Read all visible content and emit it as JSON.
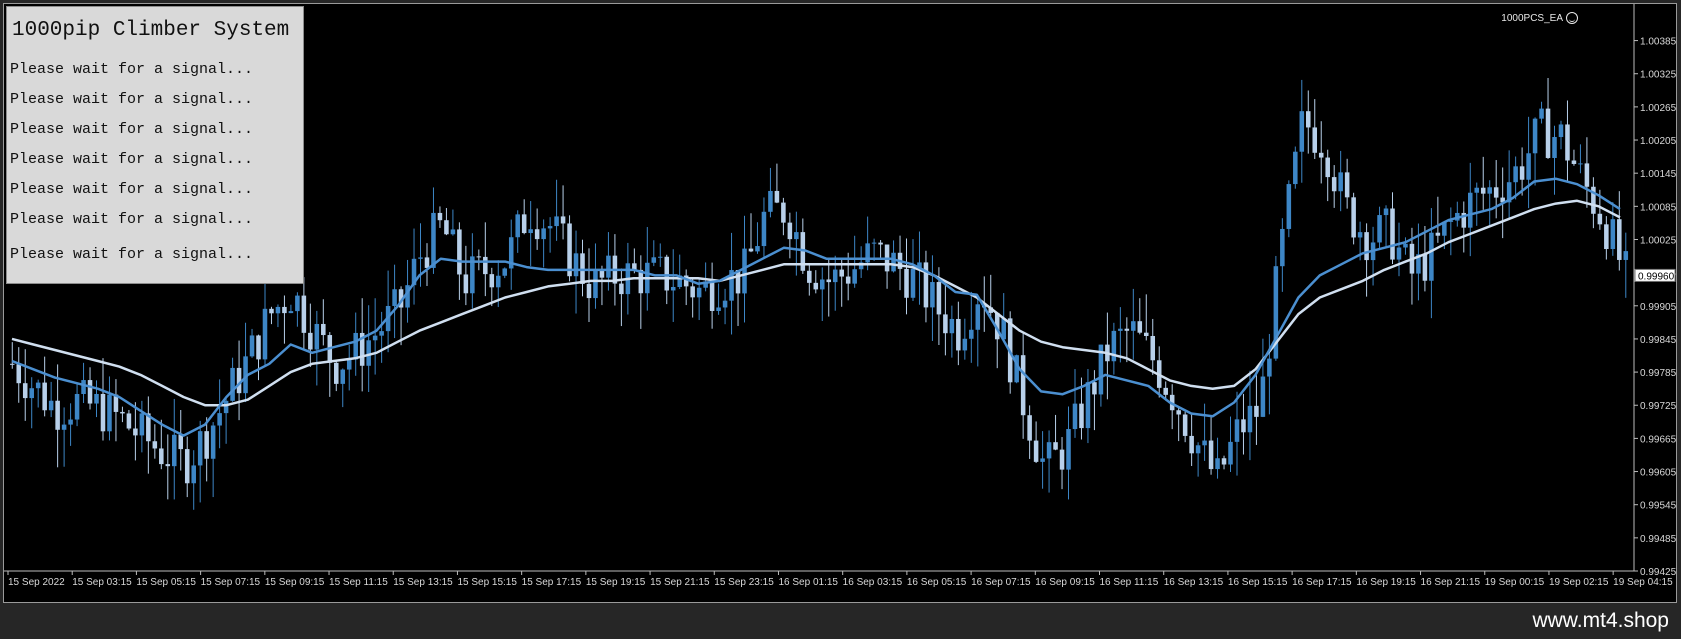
{
  "panel": {
    "title": "1000pip Climber System",
    "lines": [
      "Please wait for a signal...",
      "Please wait for a signal...",
      "Please wait for a signal...",
      "Please wait for a signal...",
      "Please wait for a signal...",
      "Please wait for a signal...",
      "Please wait for a signal..."
    ]
  },
  "ea_label": "1000PCS_EA",
  "ea_icon": "smiley-icon",
  "footer": "www.mt4.shop",
  "chart_data": {
    "type": "candlestick",
    "background": "#000000",
    "up_color": "#3d86c6",
    "down_color": "#b8d0ea",
    "ma_fast_color": "#4b8fd0",
    "ma_slow_color": "#d0dff0",
    "current_price": "0.99960",
    "ylim": [
      0.99425,
      1.00415
    ],
    "y_ticks": [
      "1.00385",
      "1.00325",
      "1.00265",
      "1.00205",
      "1.00145",
      "1.00085",
      "1.00025",
      "0.99965",
      "0.99905",
      "0.99845",
      "0.99785",
      "0.99725",
      "0.99665",
      "0.99605",
      "0.99545",
      "0.99485",
      "0.99425"
    ],
    "x_labels": [
      "15 Sep 2022",
      "15 Sep 03:15",
      "15 Sep 05:15",
      "15 Sep 07:15",
      "15 Sep 09:15",
      "15 Sep 11:15",
      "15 Sep 13:15",
      "15 Sep 15:15",
      "15 Sep 17:15",
      "15 Sep 19:15",
      "15 Sep 21:15",
      "15 Sep 23:15",
      "16 Sep 01:15",
      "16 Sep 03:15",
      "16 Sep 05:15",
      "16 Sep 07:15",
      "16 Sep 09:15",
      "16 Sep 11:15",
      "16 Sep 13:15",
      "16 Sep 15:15",
      "16 Sep 17:15",
      "16 Sep 19:15",
      "16 Sep 21:15",
      "19 Sep 00:15",
      "19 Sep 02:15",
      "19 Sep 04:15"
    ],
    "close_path": [
      0.998,
      0.9976,
      0.9972,
      0.9973,
      0.9972,
      0.997,
      0.9967,
      0.9964,
      0.9962,
      0.9967,
      0.9974,
      0.9981,
      0.9989,
      0.9993,
      0.9986,
      0.998,
      0.9982,
      0.9986,
      0.999,
      1.0,
      1.0005,
      0.9995,
      0.9997,
      0.9999,
      1.0008,
      1.0005,
      0.9999,
      0.9994,
      0.9996,
      0.9996,
      0.9996,
      0.9995,
      0.9993,
      0.9995,
      0.9996,
      1.0007,
      1.0008,
      0.9998,
      0.9995,
      0.9997,
      1.0,
      0.9998,
      0.9995,
      0.999,
      0.9986,
      0.9994,
      0.9986,
      0.9973,
      0.9961,
      0.9965,
      0.9974,
      0.9983,
      0.9986,
      0.9981,
      0.9974,
      0.9966,
      0.9959,
      0.9968,
      0.9972,
      1.0001,
      1.0024,
      1.002,
      1.0008,
      1.0003,
      1.0004,
      0.9996,
      1.0,
      1.0006,
      1.001,
      1.0012,
      1.0015,
      1.0022,
      1.0021,
      1.0013,
      1.0006,
      0.9996
    ],
    "ma_fast": [
      0.99805,
      0.9979,
      0.99775,
      0.99765,
      0.99755,
      0.9974,
      0.99715,
      0.9969,
      0.9967,
      0.9969,
      0.9974,
      0.9978,
      0.998,
      0.99835,
      0.9982,
      0.9983,
      0.9984,
      0.9986,
      0.99905,
      0.9996,
      0.9999,
      0.99985,
      0.99985,
      0.99985,
      0.99975,
      0.9997,
      0.9997,
      0.9997,
      0.9997,
      0.9997,
      0.9996,
      0.9996,
      0.99945,
      0.9995,
      0.9997,
      0.9999,
      1.0001,
      1.00005,
      0.9999,
      0.9999,
      0.9999,
      0.9999,
      0.9998,
      0.9996,
      0.9993,
      0.99925,
      0.9986,
      0.9979,
      0.9975,
      0.99745,
      0.9976,
      0.9978,
      0.9977,
      0.9976,
      0.9973,
      0.9971,
      0.99705,
      0.9973,
      0.9978,
      0.9985,
      0.9992,
      0.9996,
      0.9998,
      1.0,
      1.0001,
      1.0002,
      1.0004,
      1.0006,
      1.0007,
      1.0008,
      1.001,
      1.0013,
      1.00135,
      1.00125,
      1.00105,
      1.0008
    ],
    "ma_slow": [
      0.99845,
      0.99835,
      0.99825,
      0.99815,
      0.99805,
      0.99795,
      0.9978,
      0.9976,
      0.9974,
      0.99725,
      0.99725,
      0.99735,
      0.9976,
      0.99785,
      0.998,
      0.99805,
      0.9981,
      0.9982,
      0.9984,
      0.9986,
      0.99875,
      0.9989,
      0.99905,
      0.9992,
      0.9993,
      0.9994,
      0.99945,
      0.9995,
      0.9995,
      0.99955,
      0.99955,
      0.99955,
      0.99955,
      0.9995,
      0.9996,
      0.9997,
      0.9998,
      0.9998,
      0.9998,
      0.9998,
      0.9998,
      0.9998,
      0.99975,
      0.9996,
      0.9994,
      0.9992,
      0.9989,
      0.9986,
      0.9984,
      0.9983,
      0.99825,
      0.9982,
      0.9981,
      0.9979,
      0.9977,
      0.9976,
      0.99755,
      0.9976,
      0.9979,
      0.9984,
      0.9989,
      0.9992,
      0.99935,
      0.9995,
      0.9997,
      0.99985,
      1.0,
      1.0002,
      1.00035,
      1.0005,
      1.00065,
      1.0008,
      1.0009,
      1.00095,
      1.00085,
      1.00065
    ]
  }
}
